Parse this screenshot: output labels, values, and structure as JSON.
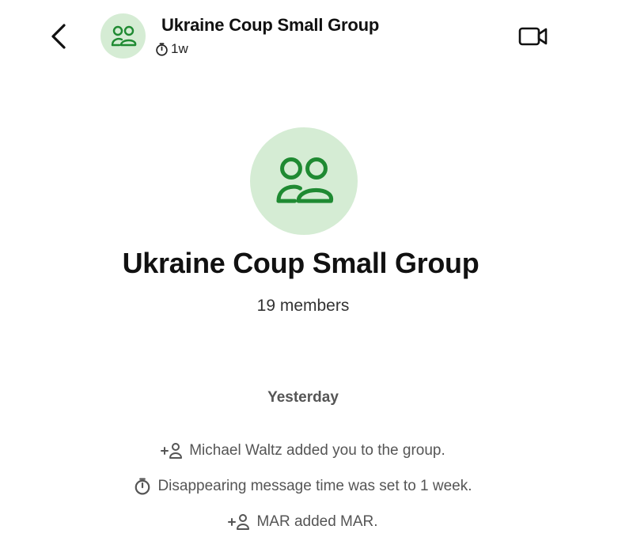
{
  "header": {
    "title": "Ukraine Coup Small Group",
    "timer_label": "1w"
  },
  "profile": {
    "name": "Ukraine Coup Small Group",
    "members": "19 members"
  },
  "timeline": {
    "day": "Yesterday",
    "events": [
      {
        "icon": "add-person-icon",
        "text": "Michael Waltz added you to the group."
      },
      {
        "icon": "timer-icon",
        "text": "Disappearing message time was set to 1 week."
      },
      {
        "icon": "add-person-icon",
        "text": "MAR added MAR."
      }
    ]
  },
  "colors": {
    "avatar_bg": "#d5ecd4",
    "avatar_fg": "#1f8a32",
    "meta_text": "#555555"
  }
}
